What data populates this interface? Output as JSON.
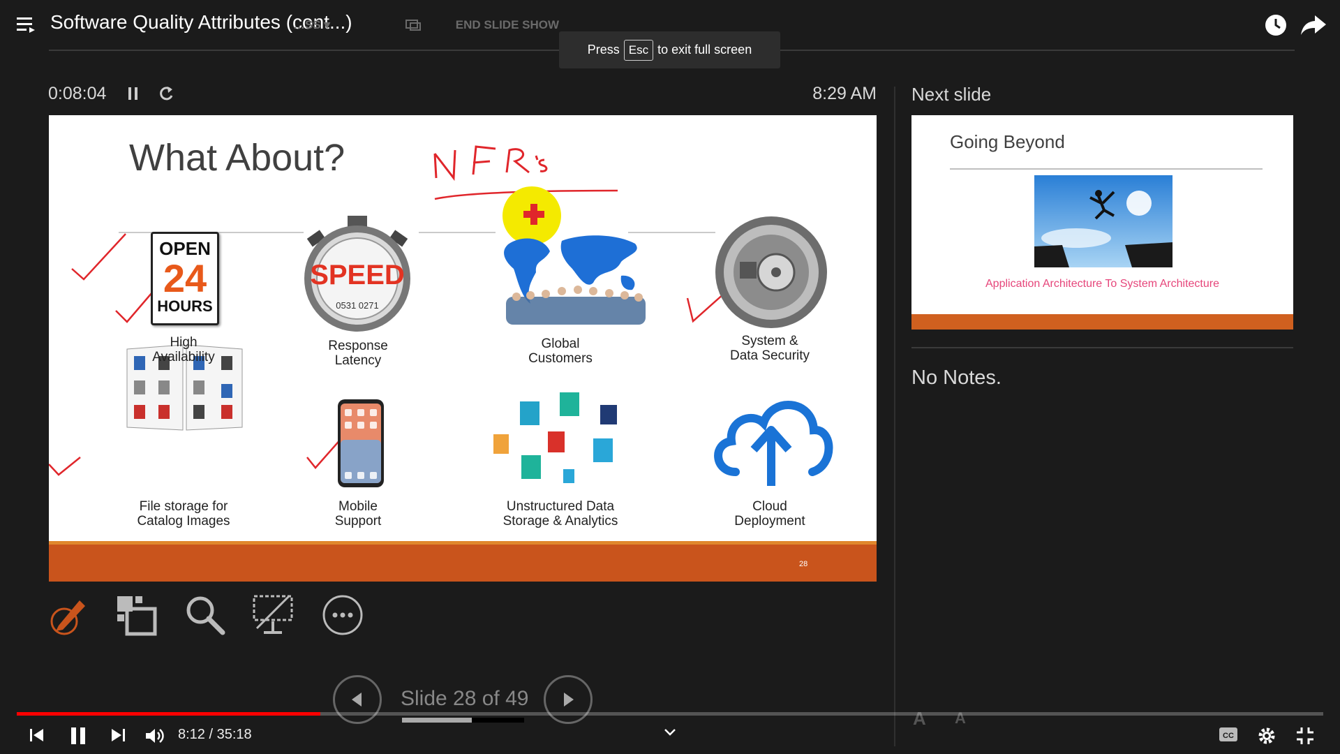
{
  "player": {
    "title": "Software Quality Attributes (cont...)",
    "toast_prefix": "Press",
    "toast_key": "Esc",
    "toast_suffix": "to exit full screen",
    "ghost_menu_text": "…SS ▾",
    "ghost_end_text": "END SLIDE SHOW",
    "time_display": "8:12 / 35:18",
    "progress_fraction": 0.2323
  },
  "presenter": {
    "elapsed": "0:08:04",
    "clock": "8:29 AM",
    "next_slide_label": "Next slide",
    "notes": "No Notes.",
    "slide_counter": "Slide 28 of 49",
    "slide_progress_fraction": 0.571,
    "font_up": "A",
    "font_down": "A"
  },
  "current_slide": {
    "title": "What About?",
    "handwriting": "NFR's",
    "number": "28",
    "tiles": [
      {
        "label1": "High",
        "label2": "Availability",
        "icon": "open-24-hours-sign",
        "sign_open": "OPEN",
        "sign_24": "24",
        "sign_hours": "HOURS"
      },
      {
        "label1": "Response",
        "label2": "Latency",
        "icon": "speed-stopwatch",
        "sign_text": "SPEED",
        "dial_text": "0531 0271"
      },
      {
        "label1": "Global",
        "label2": "Customers",
        "icon": "world-map-people"
      },
      {
        "label1": "System &",
        "label2": "Data Security",
        "icon": "vault-safe"
      },
      {
        "label1": "File storage for",
        "label2": "Catalog Images",
        "icon": "catalog-book"
      },
      {
        "label1": "Mobile",
        "label2": "Support",
        "icon": "smartphone"
      },
      {
        "label1": "Unstructured Data",
        "label2": "Storage & Analytics",
        "icon": "file-documents"
      },
      {
        "label1": "Cloud",
        "label2": "Deployment",
        "icon": "cloud-upload"
      }
    ]
  },
  "next_slide": {
    "title": "Going Beyond",
    "caption": "Application Architecture To System Architecture"
  },
  "colors": {
    "accent_orange": "#c9541c",
    "pen_red": "#e0262b",
    "youtube_red": "#ff0000",
    "cloud_blue": "#1a73d6"
  }
}
